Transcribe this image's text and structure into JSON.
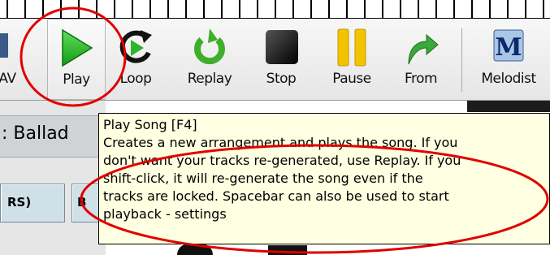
{
  "toolbar": {
    "items": [
      {
        "label": "AV"
      },
      {
        "label": "Play"
      },
      {
        "label": "Loop"
      },
      {
        "label": "Replay"
      },
      {
        "label": "Stop"
      },
      {
        "label": "Pause"
      },
      {
        "label": "From"
      },
      {
        "label": "Melodist"
      }
    ]
  },
  "song": {
    "style_text": ": Ballad"
  },
  "tracks": [
    {
      "label": "RS)"
    },
    {
      "label": "B"
    }
  ],
  "tooltip": {
    "title": "Play Song [F4]",
    "lines": [
      "Creates a new arrangement and plays the song.  If you",
      "don't want your tracks re-generated, use Replay.  If you",
      "shift-click, it will re-generate the song even if the",
      "tracks are locked.  Spacebar can also be used to start",
      "playback - settings"
    ]
  },
  "colors": {
    "play_green": "#2db52d",
    "pause_yellow": "#f2c400",
    "annotation_red": "#e00000",
    "tooltip_bg": "#ffffe1"
  }
}
